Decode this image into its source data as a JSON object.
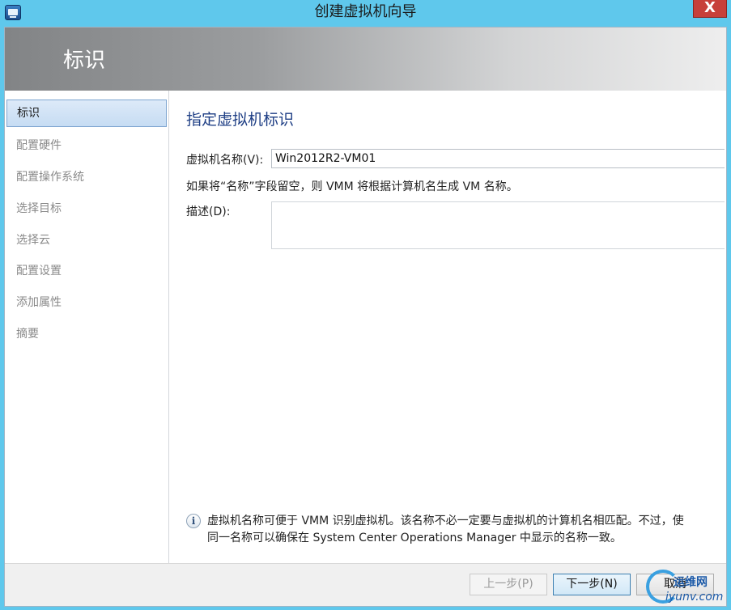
{
  "window": {
    "title": "创建虚拟机向导",
    "close_label": "X"
  },
  "banner": {
    "title": "标识"
  },
  "nav": {
    "items": [
      {
        "label": "标识",
        "active": true
      },
      {
        "label": "配置硬件",
        "active": false
      },
      {
        "label": "配置操作系统",
        "active": false
      },
      {
        "label": "选择目标",
        "active": false
      },
      {
        "label": "选择云",
        "active": false
      },
      {
        "label": "配置设置",
        "active": false
      },
      {
        "label": "添加属性",
        "active": false
      },
      {
        "label": "摘要",
        "active": false
      }
    ]
  },
  "main": {
    "section_title": "指定虚拟机标识",
    "name_label": "虚拟机名称(V):",
    "name_value": "Win2012R2-VM01",
    "hint": "如果将“名称”字段留空，则 VMM 将根据计算机名生成 VM 名称。",
    "description_label": "描述(D):",
    "description_value": "",
    "info_icon": "i",
    "info_line1": "虚拟机名称可便于 VMM 识别虚拟机。该名称不必一定要与虚拟机的计算机名相匹配。不过，使",
    "info_line2": "同一名称可以确保在 System Center Operations Manager 中显示的名称一致。"
  },
  "footer": {
    "back_label": "上一步(P)",
    "next_label": "下一步(N)",
    "cancel_label": "取消"
  },
  "watermark": {
    "top": "运维网",
    "bottom": "iyunv.com"
  }
}
